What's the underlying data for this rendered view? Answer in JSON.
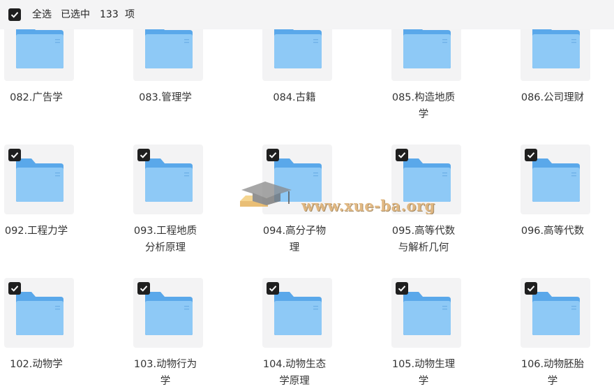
{
  "toolbar": {
    "select_all_label": "全选",
    "selected_label": "已选中",
    "selected_count": "133",
    "unit_label": "项"
  },
  "files": [
    {
      "name_line1": "082.广告学",
      "name_line2": "",
      "checked": false
    },
    {
      "name_line1": "083.管理学",
      "name_line2": "",
      "checked": false
    },
    {
      "name_line1": "084.古籍",
      "name_line2": "",
      "checked": false
    },
    {
      "name_line1": "085.构造地质",
      "name_line2": "学",
      "checked": false
    },
    {
      "name_line1": "086.公司理财",
      "name_line2": "",
      "checked": false
    },
    {
      "name_line1": "092.工程力学",
      "name_line2": "",
      "checked": true
    },
    {
      "name_line1": "093.工程地质",
      "name_line2": "分析原理",
      "checked": true
    },
    {
      "name_line1": "094.高分子物",
      "name_line2": "理",
      "checked": true
    },
    {
      "name_line1": "095.高等代数",
      "name_line2": "与解析几何",
      "checked": true
    },
    {
      "name_line1": "096.高等代数",
      "name_line2": "",
      "checked": true
    },
    {
      "name_line1": "102.动物学",
      "name_line2": "",
      "checked": true
    },
    {
      "name_line1": "103.动物行为",
      "name_line2": "学",
      "checked": true
    },
    {
      "name_line1": "104.动物生态",
      "name_line2": "学原理",
      "checked": true
    },
    {
      "name_line1": "105.动物生理",
      "name_line2": "学",
      "checked": true
    },
    {
      "name_line1": "106.动物胚胎",
      "name_line2": "学",
      "checked": true
    }
  ],
  "watermark": {
    "text": "www.xue-ba.org"
  },
  "colors": {
    "folder_back": "#5aa8ea",
    "folder_front": "#8ec9f6",
    "checkbox": "#1f1f1f",
    "thumb_bg": "#f3f3f4",
    "toolbar_bg": "#f4f4f5"
  },
  "icons": {
    "folder": "folder-icon",
    "checkbox": "checkbox-checked-icon"
  }
}
